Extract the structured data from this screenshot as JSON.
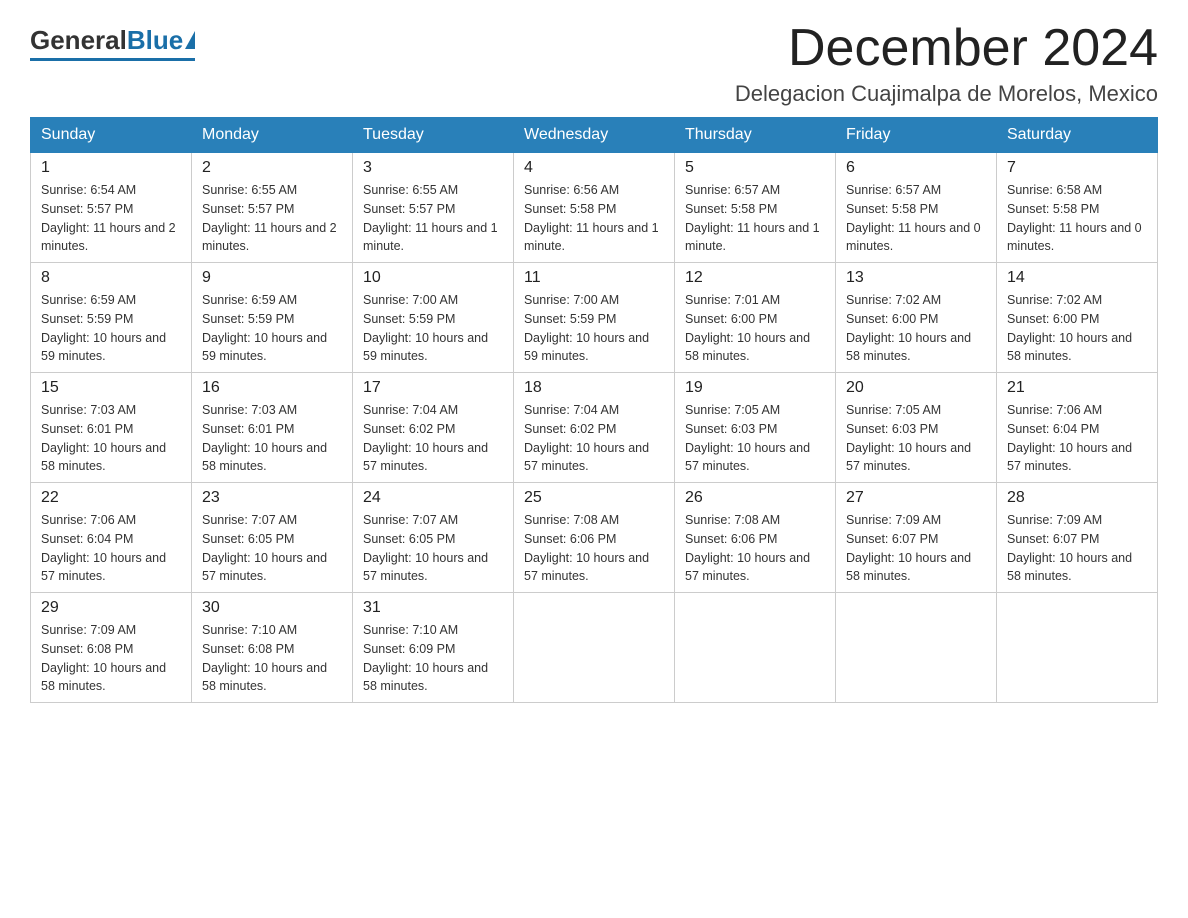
{
  "header": {
    "logo_general": "General",
    "logo_blue": "Blue",
    "month_title": "December 2024",
    "location": "Delegacion Cuajimalpa de Morelos, Mexico"
  },
  "weekdays": [
    "Sunday",
    "Monday",
    "Tuesday",
    "Wednesday",
    "Thursday",
    "Friday",
    "Saturday"
  ],
  "weeks": [
    [
      {
        "day": "1",
        "sunrise": "6:54 AM",
        "sunset": "5:57 PM",
        "daylight": "11 hours and 2 minutes."
      },
      {
        "day": "2",
        "sunrise": "6:55 AM",
        "sunset": "5:57 PM",
        "daylight": "11 hours and 2 minutes."
      },
      {
        "day": "3",
        "sunrise": "6:55 AM",
        "sunset": "5:57 PM",
        "daylight": "11 hours and 1 minute."
      },
      {
        "day": "4",
        "sunrise": "6:56 AM",
        "sunset": "5:58 PM",
        "daylight": "11 hours and 1 minute."
      },
      {
        "day": "5",
        "sunrise": "6:57 AM",
        "sunset": "5:58 PM",
        "daylight": "11 hours and 1 minute."
      },
      {
        "day": "6",
        "sunrise": "6:57 AM",
        "sunset": "5:58 PM",
        "daylight": "11 hours and 0 minutes."
      },
      {
        "day": "7",
        "sunrise": "6:58 AM",
        "sunset": "5:58 PM",
        "daylight": "11 hours and 0 minutes."
      }
    ],
    [
      {
        "day": "8",
        "sunrise": "6:59 AM",
        "sunset": "5:59 PM",
        "daylight": "10 hours and 59 minutes."
      },
      {
        "day": "9",
        "sunrise": "6:59 AM",
        "sunset": "5:59 PM",
        "daylight": "10 hours and 59 minutes."
      },
      {
        "day": "10",
        "sunrise": "7:00 AM",
        "sunset": "5:59 PM",
        "daylight": "10 hours and 59 minutes."
      },
      {
        "day": "11",
        "sunrise": "7:00 AM",
        "sunset": "5:59 PM",
        "daylight": "10 hours and 59 minutes."
      },
      {
        "day": "12",
        "sunrise": "7:01 AM",
        "sunset": "6:00 PM",
        "daylight": "10 hours and 58 minutes."
      },
      {
        "day": "13",
        "sunrise": "7:02 AM",
        "sunset": "6:00 PM",
        "daylight": "10 hours and 58 minutes."
      },
      {
        "day": "14",
        "sunrise": "7:02 AM",
        "sunset": "6:00 PM",
        "daylight": "10 hours and 58 minutes."
      }
    ],
    [
      {
        "day": "15",
        "sunrise": "7:03 AM",
        "sunset": "6:01 PM",
        "daylight": "10 hours and 58 minutes."
      },
      {
        "day": "16",
        "sunrise": "7:03 AM",
        "sunset": "6:01 PM",
        "daylight": "10 hours and 58 minutes."
      },
      {
        "day": "17",
        "sunrise": "7:04 AM",
        "sunset": "6:02 PM",
        "daylight": "10 hours and 57 minutes."
      },
      {
        "day": "18",
        "sunrise": "7:04 AM",
        "sunset": "6:02 PM",
        "daylight": "10 hours and 57 minutes."
      },
      {
        "day": "19",
        "sunrise": "7:05 AM",
        "sunset": "6:03 PM",
        "daylight": "10 hours and 57 minutes."
      },
      {
        "day": "20",
        "sunrise": "7:05 AM",
        "sunset": "6:03 PM",
        "daylight": "10 hours and 57 minutes."
      },
      {
        "day": "21",
        "sunrise": "7:06 AM",
        "sunset": "6:04 PM",
        "daylight": "10 hours and 57 minutes."
      }
    ],
    [
      {
        "day": "22",
        "sunrise": "7:06 AM",
        "sunset": "6:04 PM",
        "daylight": "10 hours and 57 minutes."
      },
      {
        "day": "23",
        "sunrise": "7:07 AM",
        "sunset": "6:05 PM",
        "daylight": "10 hours and 57 minutes."
      },
      {
        "day": "24",
        "sunrise": "7:07 AM",
        "sunset": "6:05 PM",
        "daylight": "10 hours and 57 minutes."
      },
      {
        "day": "25",
        "sunrise": "7:08 AM",
        "sunset": "6:06 PM",
        "daylight": "10 hours and 57 minutes."
      },
      {
        "day": "26",
        "sunrise": "7:08 AM",
        "sunset": "6:06 PM",
        "daylight": "10 hours and 57 minutes."
      },
      {
        "day": "27",
        "sunrise": "7:09 AM",
        "sunset": "6:07 PM",
        "daylight": "10 hours and 58 minutes."
      },
      {
        "day": "28",
        "sunrise": "7:09 AM",
        "sunset": "6:07 PM",
        "daylight": "10 hours and 58 minutes."
      }
    ],
    [
      {
        "day": "29",
        "sunrise": "7:09 AM",
        "sunset": "6:08 PM",
        "daylight": "10 hours and 58 minutes."
      },
      {
        "day": "30",
        "sunrise": "7:10 AM",
        "sunset": "6:08 PM",
        "daylight": "10 hours and 58 minutes."
      },
      {
        "day": "31",
        "sunrise": "7:10 AM",
        "sunset": "6:09 PM",
        "daylight": "10 hours and 58 minutes."
      },
      null,
      null,
      null,
      null
    ]
  ]
}
